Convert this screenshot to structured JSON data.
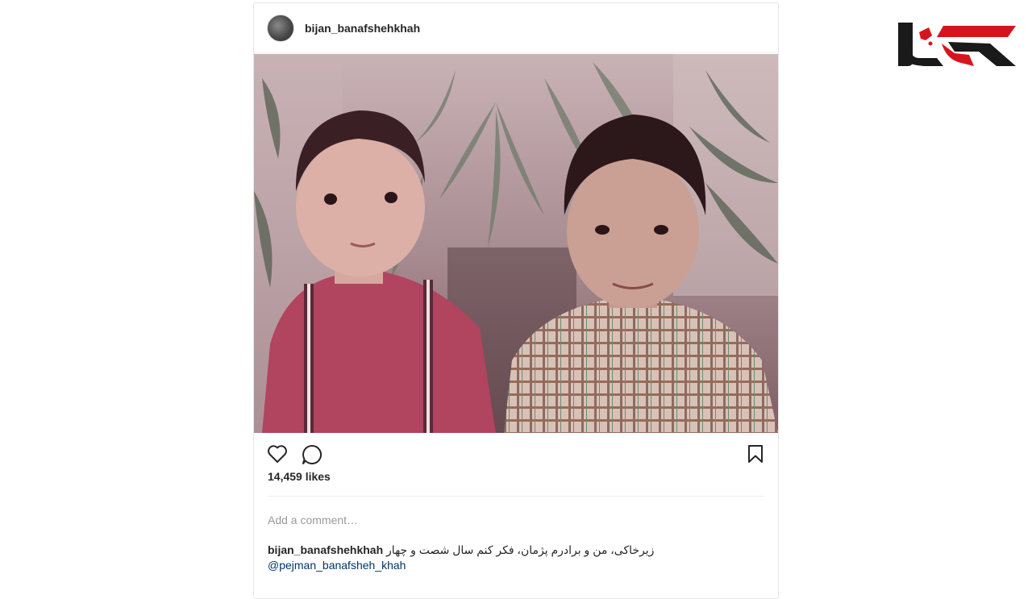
{
  "post": {
    "username": "bijan_banafshehkhah",
    "likes_text": "14,459 likes",
    "comment_placeholder": "Add a comment…",
    "caption_user": "bijan_banafshehkhah",
    "caption_text": "زیرخاکی، من و برادرم پژمان، فکر کنم سال شصت و چهار",
    "caption_mention": "@pejman_banafsheh_khah"
  },
  "icons": {
    "like": "heart-icon",
    "comment": "comment-icon",
    "save": "bookmark-icon"
  },
  "colors": {
    "logo_red": "#d7141e",
    "logo_dark": "#1a1a1a",
    "mention": "#003569"
  }
}
